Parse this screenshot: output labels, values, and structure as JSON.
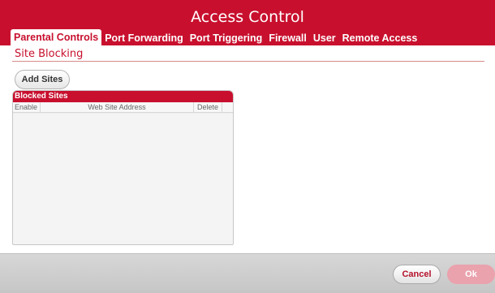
{
  "app": {
    "title": "Access Control"
  },
  "tabs": [
    {
      "label": "Parental Controls",
      "active": true
    },
    {
      "label": "Port Forwarding",
      "active": false
    },
    {
      "label": "Port Triggering",
      "active": false
    },
    {
      "label": "Firewall",
      "active": false
    },
    {
      "label": "User",
      "active": false
    },
    {
      "label": "Remote Access",
      "active": false
    }
  ],
  "section": {
    "title": "Site Blocking"
  },
  "add_sites": {
    "label": "Add Sites"
  },
  "blocked_sites": {
    "title": "Blocked Sites",
    "columns": [
      "Enable",
      "Web Site Address",
      "Delete"
    ],
    "rows": []
  },
  "footer": {
    "cancel_label": "Cancel",
    "ok_label": "Ok"
  },
  "colors": {
    "brand_red": "#c8102e",
    "ok_disabled": "#eaa2ad"
  }
}
